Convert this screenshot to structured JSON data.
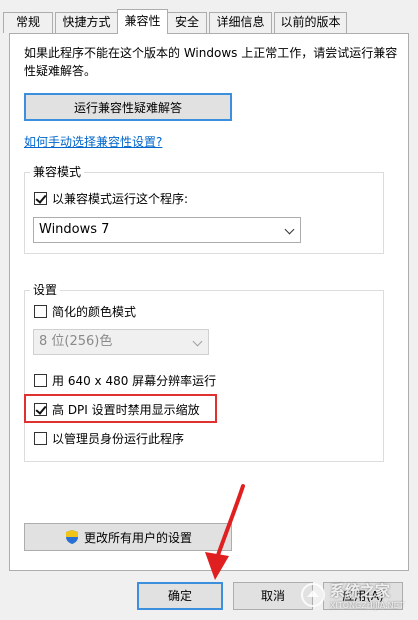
{
  "tabs": [
    {
      "label": "常规"
    },
    {
      "label": "快捷方式"
    },
    {
      "label": "兼容性"
    },
    {
      "label": "安全"
    },
    {
      "label": "详细信息"
    },
    {
      "label": "以前的版本"
    }
  ],
  "description": "如果此程序不能在这个版本的 Windows 上正常工作，请尝试运行兼容性疑难解答。",
  "troubleshoot_button": "运行兼容性疑难解答",
  "manual_link": "如何手动选择兼容性设置?",
  "compat_mode": {
    "label": "兼容模式",
    "run_compat_checkbox": "以兼容模式运行这个程序:",
    "run_compat_checked": true,
    "os_select": "Windows 7"
  },
  "settings": {
    "label": "设置",
    "reduced_color": {
      "label": "简化的颜色模式",
      "checked": false
    },
    "color_select": "8 位(256)色",
    "res_640": {
      "label": "用 640 x 480 屏幕分辨率运行",
      "checked": false
    },
    "high_dpi": {
      "label": "高 DPI 设置时禁用显示缩放",
      "checked": true
    },
    "run_admin": {
      "label": "以管理员身份运行此程序",
      "checked": false
    }
  },
  "all_users_button": "更改所有用户的设置",
  "bottom_buttons": {
    "ok": "确定",
    "cancel": "取消",
    "apply": "应用(A)"
  },
  "watermark": {
    "text": "系统之家",
    "sub": "XITONGZHIJIA.NET"
  },
  "colors": {
    "focus_blue": "#3c8fdc",
    "highlight_red": "#e03030",
    "link_blue": "#0066cc",
    "arrow_red": "#e02020"
  }
}
